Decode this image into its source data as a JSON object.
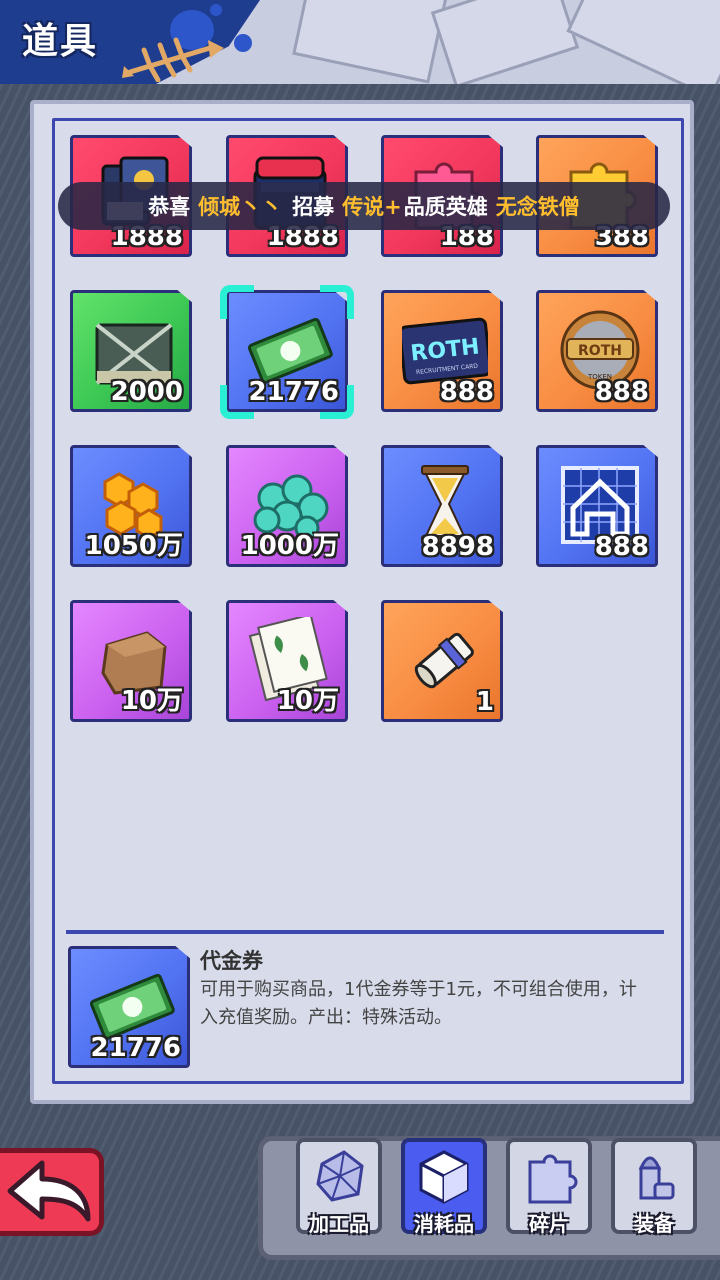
{
  "header": {
    "title": "道具"
  },
  "banner": {
    "prefix": "恭喜",
    "player": "倾城丶丶",
    "action": "招募",
    "quality": "传说+",
    "middle": "品质英雄",
    "hero": "无念铁僧"
  },
  "items": [
    {
      "name": "card-pack",
      "count": "1888",
      "color": "red"
    },
    {
      "name": "red-chest",
      "count": "1888",
      "color": "red"
    },
    {
      "name": "red-puzzle-piece",
      "count": "188",
      "color": "red"
    },
    {
      "name": "gold-puzzle-piece",
      "count": "388",
      "color": "orange"
    },
    {
      "name": "supply-crate",
      "count": "2000",
      "color": "green"
    },
    {
      "name": "voucher",
      "count": "21776",
      "color": "blue",
      "selected": true
    },
    {
      "name": "roth-recruitment-card",
      "count": "888",
      "color": "orange",
      "text_main": "ROTH",
      "text_sub": "RECRUITMENT CARD"
    },
    {
      "name": "roth-token",
      "count": "888",
      "color": "orange",
      "text_main": "ROTH",
      "text_sub": "TOKEN"
    },
    {
      "name": "gold-crystals",
      "count": "1050万",
      "color": "blue"
    },
    {
      "name": "teal-orbs",
      "count": "1000万",
      "color": "purple"
    },
    {
      "name": "hourglass",
      "count": "8898",
      "color": "blue"
    },
    {
      "name": "blueprint",
      "count": "888",
      "color": "blue"
    },
    {
      "name": "dirt-block",
      "count": "10万",
      "color": "purple"
    },
    {
      "name": "plant-papers",
      "count": "10万",
      "color": "purple"
    },
    {
      "name": "scroll",
      "count": "1",
      "color": "orange"
    }
  ],
  "detail": {
    "name": "代金券",
    "description": "可用于购买商品，1代金券等于1元，不可组合使用，计入充值奖励。产出：特殊活动。",
    "count": "21776"
  },
  "tabs": [
    {
      "label": "加工品",
      "icon": "crystal-icon",
      "active": false
    },
    {
      "label": "消耗品",
      "icon": "cube-icon",
      "active": true
    },
    {
      "label": "碎片",
      "icon": "puzzle-icon",
      "active": false
    },
    {
      "label": "装备",
      "icon": "bullet-icon",
      "active": false
    }
  ]
}
